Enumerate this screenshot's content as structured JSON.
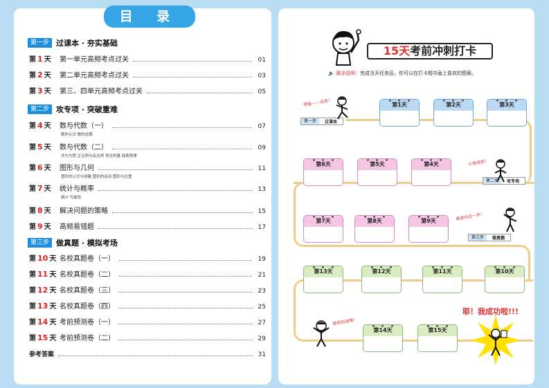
{
  "toc": {
    "title": "目 录",
    "sections": [
      {
        "badge": "第一步",
        "title": "过课本 · 夯实基础"
      },
      {
        "badge": "第二步",
        "title": "攻专项 · 突破重难"
      },
      {
        "badge": "第三步",
        "title": "做真题 · 模拟考场"
      }
    ],
    "entries": [
      {
        "pre": "第",
        "num": "1",
        "post": "天",
        "title": "第一单元高频考点过关",
        "page": "01"
      },
      {
        "pre": "第",
        "num": "2",
        "post": "天",
        "title": "第二单元高频考点过关",
        "page": "03"
      },
      {
        "pre": "第",
        "num": "3",
        "post": "天",
        "title": "第三、四单元高频考点过关",
        "page": "05"
      },
      {
        "pre": "第",
        "num": "4",
        "post": "天",
        "title": "数与代数（一）",
        "page": "07",
        "sub": "数的认识  数的运算"
      },
      {
        "pre": "第",
        "num": "5",
        "post": "天",
        "title": "数与代数（二）",
        "page": "09",
        "sub": "式与方程  正比例与反比例  常见的量  探索规律"
      },
      {
        "pre": "第",
        "num": "6",
        "post": "天",
        "title": "图形与几何",
        "page": "11",
        "sub": "图形的认识与测量  图形的运动  图形与位置"
      },
      {
        "pre": "第",
        "num": "7",
        "post": "天",
        "title": "统计与概率",
        "page": "13",
        "sub": "统计  可能性"
      },
      {
        "pre": "第",
        "num": "8",
        "post": "天",
        "title": "解决问题的策略",
        "page": "15"
      },
      {
        "pre": "第",
        "num": "9",
        "post": "天",
        "title": "高频易错题",
        "page": "17"
      },
      {
        "pre": "第",
        "num": "10",
        "post": "天",
        "title": "名校真题卷（一）",
        "page": "19"
      },
      {
        "pre": "第",
        "num": "11",
        "post": "天",
        "title": "名校真题卷（二）",
        "page": "21"
      },
      {
        "pre": "第",
        "num": "12",
        "post": "天",
        "title": "名校真题卷（三）",
        "page": "23"
      },
      {
        "pre": "第",
        "num": "13",
        "post": "天",
        "title": "名校真题卷（四）",
        "page": "25"
      },
      {
        "pre": "第",
        "num": "14",
        "post": "天",
        "title": "考前预测卷（一）",
        "page": "27"
      },
      {
        "pre": "第",
        "num": "15",
        "post": "天",
        "title": "考前预测卷（二）",
        "page": "29"
      }
    ],
    "answers": {
      "title": "参考答案",
      "page": "31"
    }
  },
  "checkin": {
    "banner_red": "15天",
    "banner_rest": "考前冲刺打卡",
    "tip_label": "填涂说明：",
    "tip_text": "完成当天任务后，你可以在打卡框中画上喜欢的图案。",
    "cards": [
      "第1天",
      "第2天",
      "第3天",
      "第6天",
      "第5天",
      "第4天",
      "第7天",
      "第8天",
      "第9天",
      "第13天",
      "第12天",
      "第11天",
      "第10天",
      "第14天",
      "第15天"
    ],
    "steps": [
      {
        "step": "第一步",
        "name": "过课本"
      },
      {
        "step": "第二步",
        "name": "攻专项"
      },
      {
        "step": "第三步",
        "name": "做真题"
      }
    ],
    "signs": [
      "预备——出发！",
      "小有成就！",
      "离成功近一步！",
      "继续加油哦！"
    ],
    "success": "耶！我成功啦!!!"
  },
  "colors": {
    "accent": "#1e8fe0",
    "red": "#e02020",
    "path": "#f1cc86"
  }
}
